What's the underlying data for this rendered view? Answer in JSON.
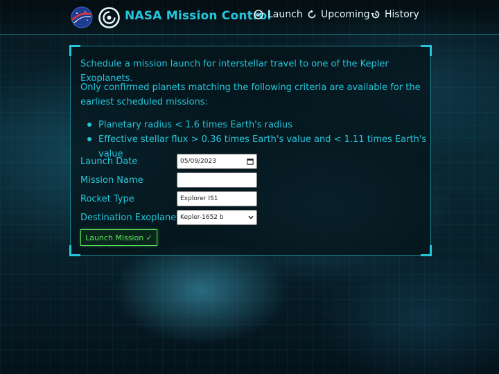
{
  "header": {
    "brand": "NASA Mission Control",
    "nav": [
      {
        "label": "Launch",
        "icon": "check-circle-icon"
      },
      {
        "label": "Upcoming",
        "icon": "refresh-icon"
      },
      {
        "label": "History",
        "icon": "history-icon"
      }
    ]
  },
  "panel": {
    "intro": "Schedule a mission launch for interstellar travel to one of the Kepler Exoplanets.",
    "criteria": "Only confirmed planets matching the following criteria are available for the earliest scheduled missions:",
    "bullets": [
      "Planetary radius < 1.6 times Earth's radius",
      "Effective stellar flux > 0.36 times Earth's value and < 1.11 times Earth's value"
    ]
  },
  "form": {
    "launch_date": {
      "label": "Launch Date",
      "value": "05/09/2023"
    },
    "mission_name": {
      "label": "Mission Name",
      "value": ""
    },
    "rocket_type": {
      "label": "Rocket Type",
      "value": "Explorer IS1"
    },
    "destination": {
      "label": "Destination Exoplanet",
      "value": "Kepler-1652 b"
    },
    "submit_label": "Launch Mission ✓"
  },
  "colors": {
    "accent": "#26c6da",
    "submit": "#5fe35f",
    "nav_text": "#e8f6f8"
  }
}
